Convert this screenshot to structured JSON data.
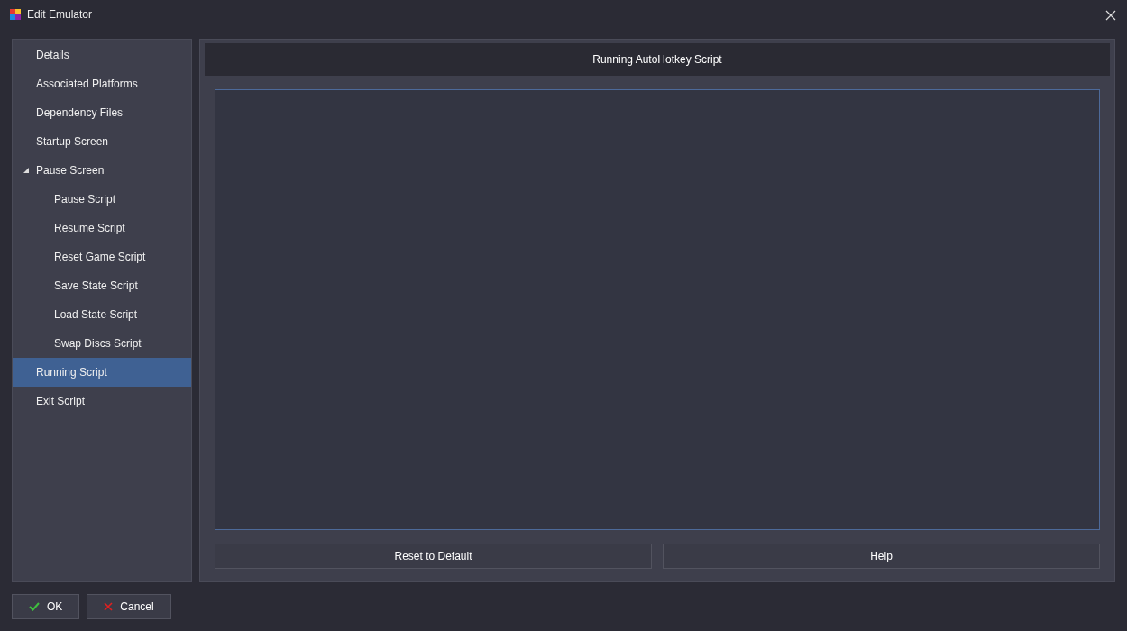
{
  "window": {
    "title": "Edit Emulator"
  },
  "sidebar": {
    "items": [
      {
        "label": "Details",
        "selected": false
      },
      {
        "label": "Associated Platforms",
        "selected": false
      },
      {
        "label": "Dependency Files",
        "selected": false
      },
      {
        "label": "Startup Screen",
        "selected": false
      },
      {
        "label": "Pause Screen",
        "selected": false,
        "expanded": true,
        "children": [
          {
            "label": "Pause Script",
            "selected": false
          },
          {
            "label": "Resume Script",
            "selected": false
          },
          {
            "label": "Reset Game Script",
            "selected": false
          },
          {
            "label": "Save State Script",
            "selected": false
          },
          {
            "label": "Load State Script",
            "selected": false
          },
          {
            "label": "Swap Discs Script",
            "selected": false
          }
        ]
      },
      {
        "label": "Running Script",
        "selected": true
      },
      {
        "label": "Exit Script",
        "selected": false
      }
    ]
  },
  "panel": {
    "header": "Running AutoHotkey Script",
    "buttons": [
      "Reset to Default",
      "Help"
    ]
  },
  "footer": {
    "buttons": [
      {
        "kind": "ok",
        "label": "OK"
      },
      {
        "kind": "cancel",
        "label": "Cancel"
      }
    ]
  }
}
